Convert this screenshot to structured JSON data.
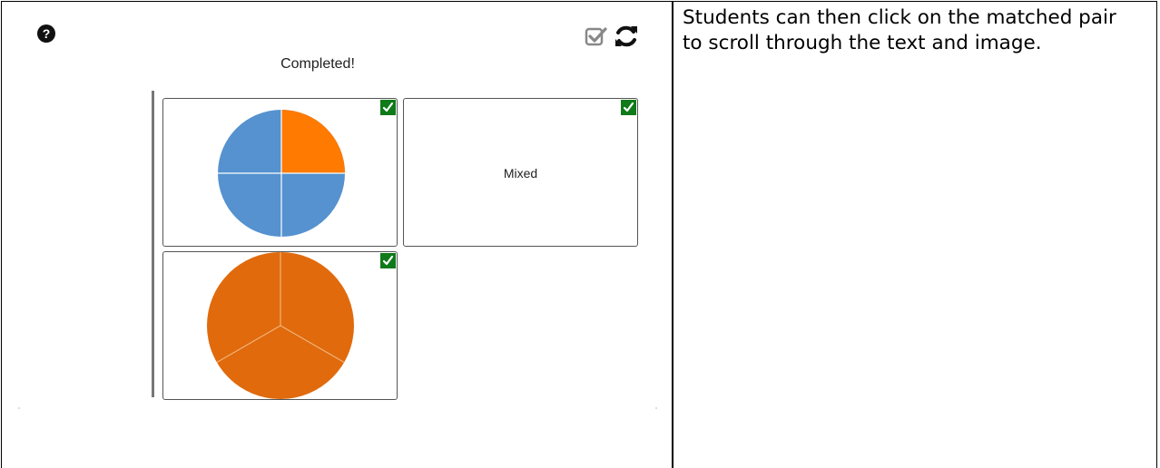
{
  "activity": {
    "status_text": "Completed!",
    "cards": [
      {
        "type": "image",
        "pie_fraction": "1/4 orange"
      },
      {
        "type": "text",
        "label": "Mixed"
      },
      {
        "type": "image",
        "pie_fraction": "3/3 orange"
      }
    ],
    "icons": [
      "help-icon",
      "check-all-icon",
      "reset-icon",
      "checkmark-icon"
    ],
    "colors": {
      "blue": "#5592cf",
      "orange_light": "#ff7a00",
      "orange_dark": "#e06a0c",
      "badge_green": "#0f7a1a"
    }
  },
  "instruction": {
    "text": "Students can then click on the matched pair to scroll through the text and image."
  }
}
